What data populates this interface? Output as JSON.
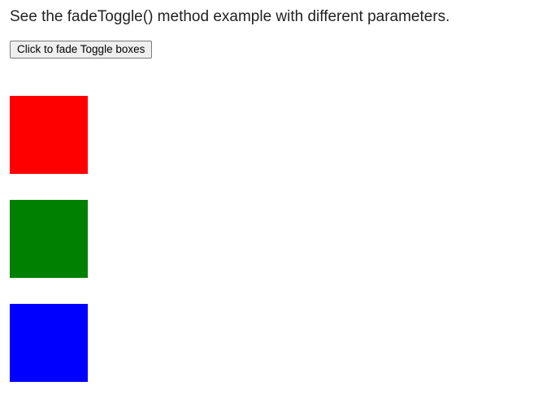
{
  "heading": "See the fadeToggle() method example with different parameters.",
  "button": {
    "label": "Click to fade Toggle boxes"
  },
  "boxes": [
    {
      "color": "#ff0000"
    },
    {
      "color": "#008000"
    },
    {
      "color": "#0000ff"
    }
  ]
}
